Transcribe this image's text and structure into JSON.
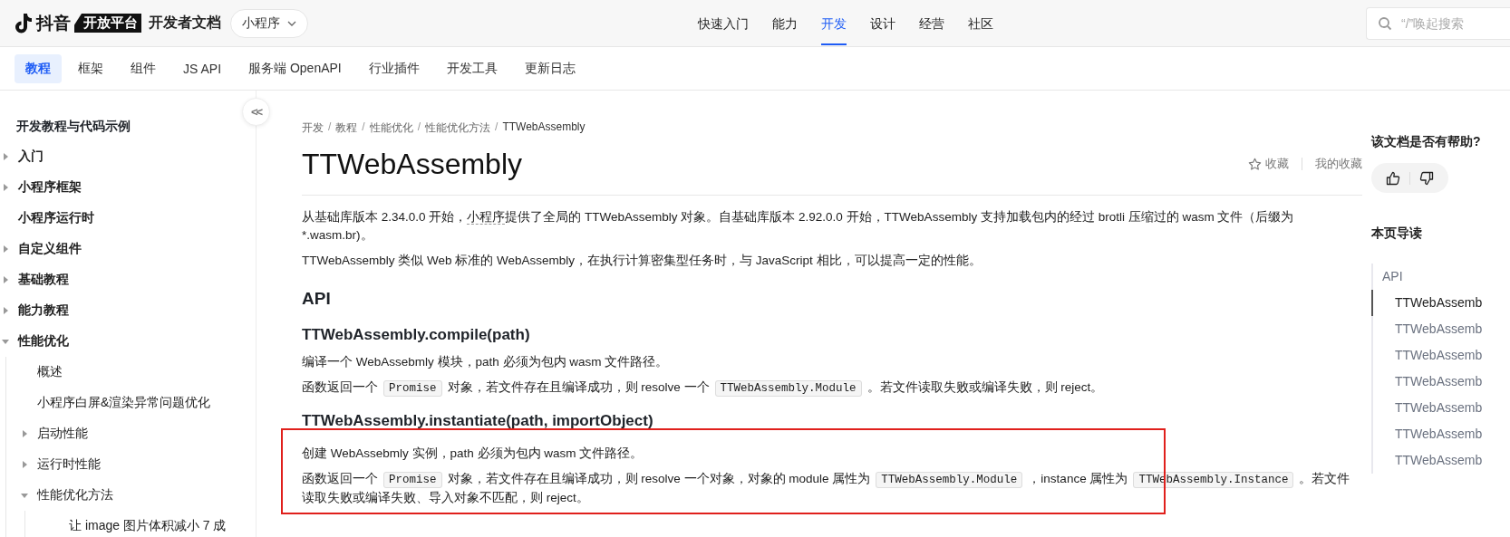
{
  "header": {
    "logo_text": "抖音",
    "logo_badge": "开放平台",
    "site_title": "开发者文档",
    "product_switch": "小程序",
    "nav": [
      {
        "label": "快速入门",
        "selected": false
      },
      {
        "label": "能力",
        "selected": false
      },
      {
        "label": "开发",
        "selected": true
      },
      {
        "label": "设计",
        "selected": false
      },
      {
        "label": "经营",
        "selected": false
      },
      {
        "label": "社区",
        "selected": false
      }
    ],
    "product_switch_open": false,
    "search": {
      "placeholder": "“/”唤起搜索"
    }
  },
  "subnav": [
    {
      "label": "教程",
      "selected": true
    },
    {
      "label": "框架",
      "selected": false
    },
    {
      "label": "组件",
      "selected": false
    },
    {
      "label": "JS API",
      "selected": false
    },
    {
      "label": "服务端 OpenAPI",
      "selected": false
    },
    {
      "label": "行业插件",
      "selected": false
    },
    {
      "label": "开发工具",
      "selected": false
    },
    {
      "label": "更新日志",
      "selected": false
    }
  ],
  "sidebar": {
    "title": "开发教程与代码示例",
    "collapse_button": "<<",
    "items": [
      {
        "label": "入门",
        "expanded": false
      },
      {
        "label": "小程序框架",
        "expanded": false
      },
      {
        "label": "小程序运行时"
      },
      {
        "label": "自定义组件",
        "expanded": false
      },
      {
        "label": "基础教程",
        "expanded": false
      },
      {
        "label": "能力教程",
        "expanded": false
      },
      {
        "label": "性能优化",
        "expanded": true,
        "children": [
          {
            "label": "概述"
          },
          {
            "label": "小程序白屏&渲染异常问题优化"
          },
          {
            "label": "启动性能",
            "expanded": false
          },
          {
            "label": "运行时性能",
            "expanded": false
          },
          {
            "label": "性能优化方法",
            "expanded": true,
            "children": [
              {
                "label": "让 image 图片体积减小 7 成"
              }
            ]
          }
        ]
      }
    ]
  },
  "breadcrumb": [
    "开发",
    "教程",
    "性能优化",
    "性能优化方法",
    "TTWebAssembly"
  ],
  "breadcrumb_separator": "/",
  "title": "TTWebAssembly",
  "actions": {
    "favorite": "收藏",
    "my_favorites": "我的收藏"
  },
  "content": [
    {
      "kind": "p",
      "parts": [
        {
          "kind": "text",
          "text": "从基础库版本 2.34.0.0 开始，"
        },
        {
          "kind": "term",
          "text": "小程序"
        },
        {
          "kind": "text",
          "text": "提供了全局的 TTWebAssembly 对象。自基础库版本 2.92.0.0 开始，TTWebAssembly 支持加载包内的经过 brotli 压缩过的 wasm 文件（后缀为 *.wasm.br)。"
        }
      ]
    },
    {
      "kind": "p",
      "parts": [
        {
          "kind": "text",
          "text": "TTWebAssembly 类似 Web 标准的 WebAssembly，在执行计算密集型任务时，与 JavaScript 相比，可以提高一定的性能。"
        }
      ]
    },
    {
      "kind": "h2",
      "text": "API"
    },
    {
      "kind": "h3",
      "text": "TTWebAssembly.compile(path)"
    },
    {
      "kind": "p",
      "parts": [
        {
          "kind": "text",
          "text": "编译一个 WebAssebmly 模块，path 必须为包内 wasm 文件路径。"
        }
      ]
    },
    {
      "kind": "p",
      "parts": [
        {
          "kind": "text",
          "text": "函数返回一个"
        },
        {
          "kind": "code",
          "text": "Promise"
        },
        {
          "kind": "text",
          "text": "对象，若文件存在且编译成功，则 resolve 一个"
        },
        {
          "kind": "code",
          "text": "TTWebAssembly.Module"
        },
        {
          "kind": "text",
          "text": "。若文件读取失败或编译失败，则 reject。"
        }
      ]
    },
    {
      "kind": "h3",
      "text": "TTWebAssembly.instantiate(path, importObject)"
    },
    {
      "kind": "block",
      "highlighted": true,
      "items": [
        {
          "kind": "p",
          "parts": [
            {
              "kind": "text",
              "text": "创建 WebAssebmly 实例，path 必须为包内 wasm 文件路径。"
            }
          ]
        },
        {
          "kind": "p",
          "parts": [
            {
              "kind": "text",
              "text": "函数返回一个"
            },
            {
              "kind": "code",
              "text": "Promise"
            },
            {
              "kind": "text",
              "text": "对象，若文件存在且编译成功，则 resolve 一个对象，对象的 module 属性为"
            },
            {
              "kind": "code",
              "text": "TTWebAssembly.Module"
            },
            {
              "kind": "text",
              "text": "，instance 属性为"
            },
            {
              "kind": "code",
              "text": "TTWebAssembly.Instance"
            },
            {
              "kind": "text",
              "text": "。若文件读取失败或编译失败、导入对象不匹配，则 reject。"
            }
          ]
        }
      ]
    }
  ],
  "aside": {
    "feedback_title": "该文档是否有帮助?",
    "toc_title": "本页导读",
    "toc": [
      {
        "label": "API",
        "selected": false,
        "children": [
          {
            "label": "TTWebAssemb",
            "selected": true
          },
          {
            "label": "TTWebAssemb",
            "selected": false
          },
          {
            "label": "TTWebAssemb",
            "selected": false
          },
          {
            "label": "TTWebAssemb",
            "selected": false
          },
          {
            "label": "TTWebAssemb",
            "selected": false
          },
          {
            "label": "TTWebAssemb",
            "selected": false
          },
          {
            "label": "TTWebAssemb",
            "selected": false
          }
        ]
      }
    ]
  }
}
